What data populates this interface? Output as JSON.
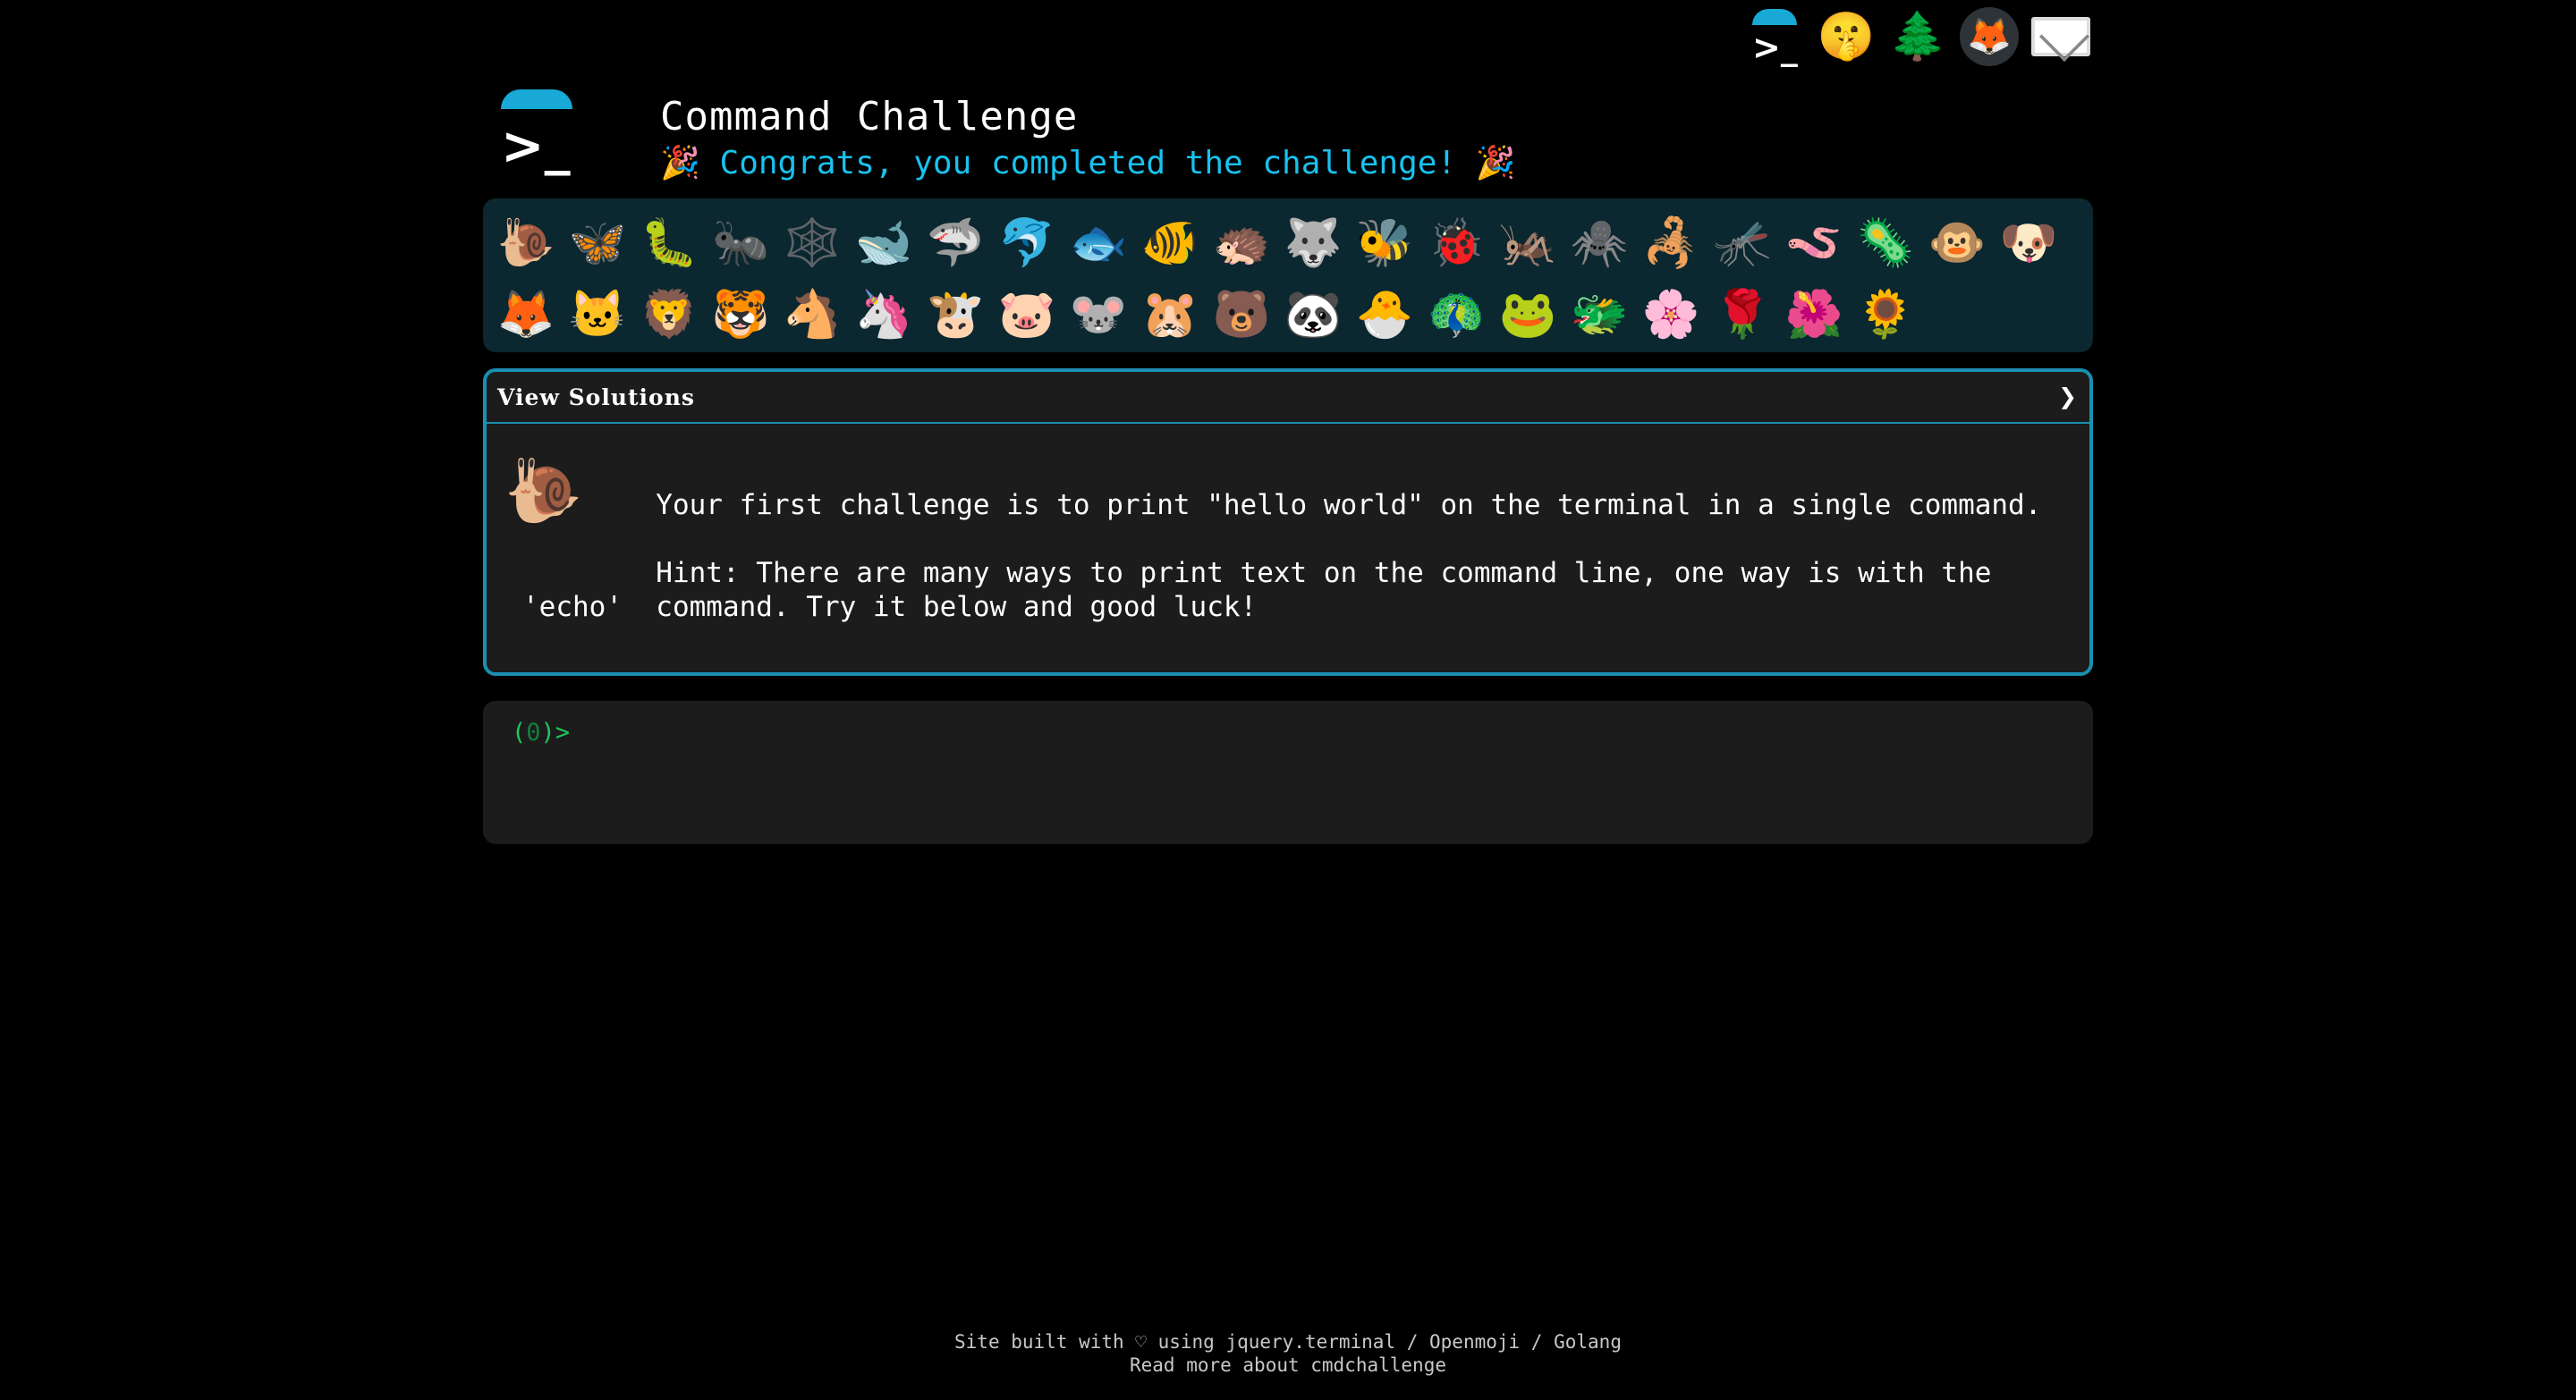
{
  "topnav": {
    "items": [
      {
        "name": "home-logo-icon",
        "glyph": ""
      },
      {
        "name": "shushing-face-icon",
        "glyph": "🤫"
      },
      {
        "name": "tree-icon",
        "glyph": "🌲"
      },
      {
        "name": "gitlab-fox-icon",
        "glyph": "🦊"
      },
      {
        "name": "mail-icon",
        "glyph": ""
      }
    ],
    "logo_prompt": ">_"
  },
  "header": {
    "logo_prompt": ">_",
    "title": "Command Challenge",
    "subtitle_emoji": "🎉",
    "subtitle": "Congrats, you completed the challenge!"
  },
  "animals": {
    "row1": [
      "🐌",
      "🦋",
      "🐛",
      "🐜",
      "🕸️",
      "🐋",
      "🦈",
      "🐬",
      "🐟",
      "🐠",
      "🦔",
      "🐺",
      "🐝",
      "🐞",
      "🦗",
      "🕷️",
      "🦂",
      "🦟",
      "🪱",
      "🦠",
      "🐵",
      "🐶"
    ],
    "row2": [
      "🦊",
      "🐱",
      "🦁",
      "🐯",
      "🐴",
      "🦄",
      "🐮",
      "🐷",
      "🐭",
      "🐹",
      "🐻",
      "🐼",
      "🐣",
      "🦚",
      "🐸",
      "🐲",
      "🌸",
      "🌹",
      "🌺",
      "🌻"
    ]
  },
  "solution": {
    "header_label": "View Solutions",
    "chevron": "❯",
    "icon": "🐌",
    "text": "        Your first challenge is to print \"hello world\" on the terminal in a single command.\n\n        Hint: There are many ways to print text on the command line, one way is with the\n'echo'  command. Try it below and good luck!"
  },
  "terminal": {
    "prompt_open": "(",
    "count": "0",
    "prompt_close": ")>"
  },
  "footer": {
    "line1": "Site built with ♡ using jquery.terminal / Openmoji / Golang",
    "line2": "Read more about cmdchallenge"
  },
  "colors": {
    "accent": "#18c2ef",
    "panel_border": "#1a8fb0",
    "animal_panel_bg": "#0b2730",
    "prompt_green": "#22c55e"
  }
}
